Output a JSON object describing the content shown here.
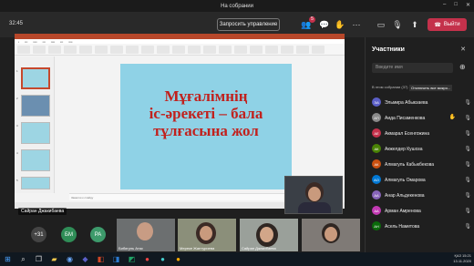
{
  "window": {
    "title": "На собрании",
    "controls": [
      "–",
      "□",
      "✕"
    ]
  },
  "toolbar": {
    "time": "32:45",
    "request_control_label": "Запросить управление",
    "participants_badge": "5",
    "leave_label": "Выйти",
    "leave_color": "#c4314b"
  },
  "share": {
    "slide_lines": [
      "Мұғалімнің",
      "іс-әрекеті – бала",
      "тұлғасына жол"
    ],
    "notes_label": "Заметки к слайду",
    "sharer_name": "Сайран Джакибаева",
    "title_color": "#c1211d",
    "slide_bg": "#8fd2e6"
  },
  "strip": {
    "more_count": "+31",
    "avatars": [
      {
        "initials": "БМ",
        "color": "#2f8d57"
      },
      {
        "initials": "РА",
        "color": "#3d9a6b"
      }
    ],
    "tiles": [
      {
        "name": "Бибигуль Атас"
      },
      {
        "name": "Мереке Жантуриева"
      },
      {
        "name": "Сайран Джакибаева"
      },
      {
        "name": ""
      }
    ]
  },
  "panel": {
    "title": "Участники",
    "search_placeholder": "Введите имя",
    "section_label": "В этом собрании (37)",
    "mute_all_label": "Отключить все микро...",
    "participants": [
      {
        "name": "Эльмира Абыкзаева",
        "initials": "ЭА",
        "color": "#5b5fc7",
        "hand": false
      },
      {
        "name": "Аида Писаменкова",
        "initials": "АП",
        "color": "#8a8a8a",
        "hand": true
      },
      {
        "name": "Акмарал Есенгожина",
        "initials": "АЕ",
        "color": "#c4314b",
        "hand": false
      },
      {
        "name": "Акжелдер Кушоза",
        "initials": "АК",
        "color": "#498205",
        "hand": false
      },
      {
        "name": "Алмагуль Кабыкбекова",
        "initials": "АК",
        "color": "#ca5010",
        "hand": false
      },
      {
        "name": "Алмагуль Омарова",
        "initials": "АО",
        "color": "#0078d4",
        "hand": false
      },
      {
        "name": "Анар Альдекенова",
        "initials": "АА",
        "color": "#8764b8",
        "hand": false
      },
      {
        "name": "Арман Амренова",
        "initials": "АА",
        "color": "#c239b3",
        "hand": false
      },
      {
        "name": "Асель Наметова",
        "initials": "АН",
        "color": "#0b6a0b",
        "hand": false
      }
    ]
  },
  "taskbar": {
    "lang": "ҚАЗ",
    "clock": "15:21",
    "date": "13.11.2020"
  }
}
